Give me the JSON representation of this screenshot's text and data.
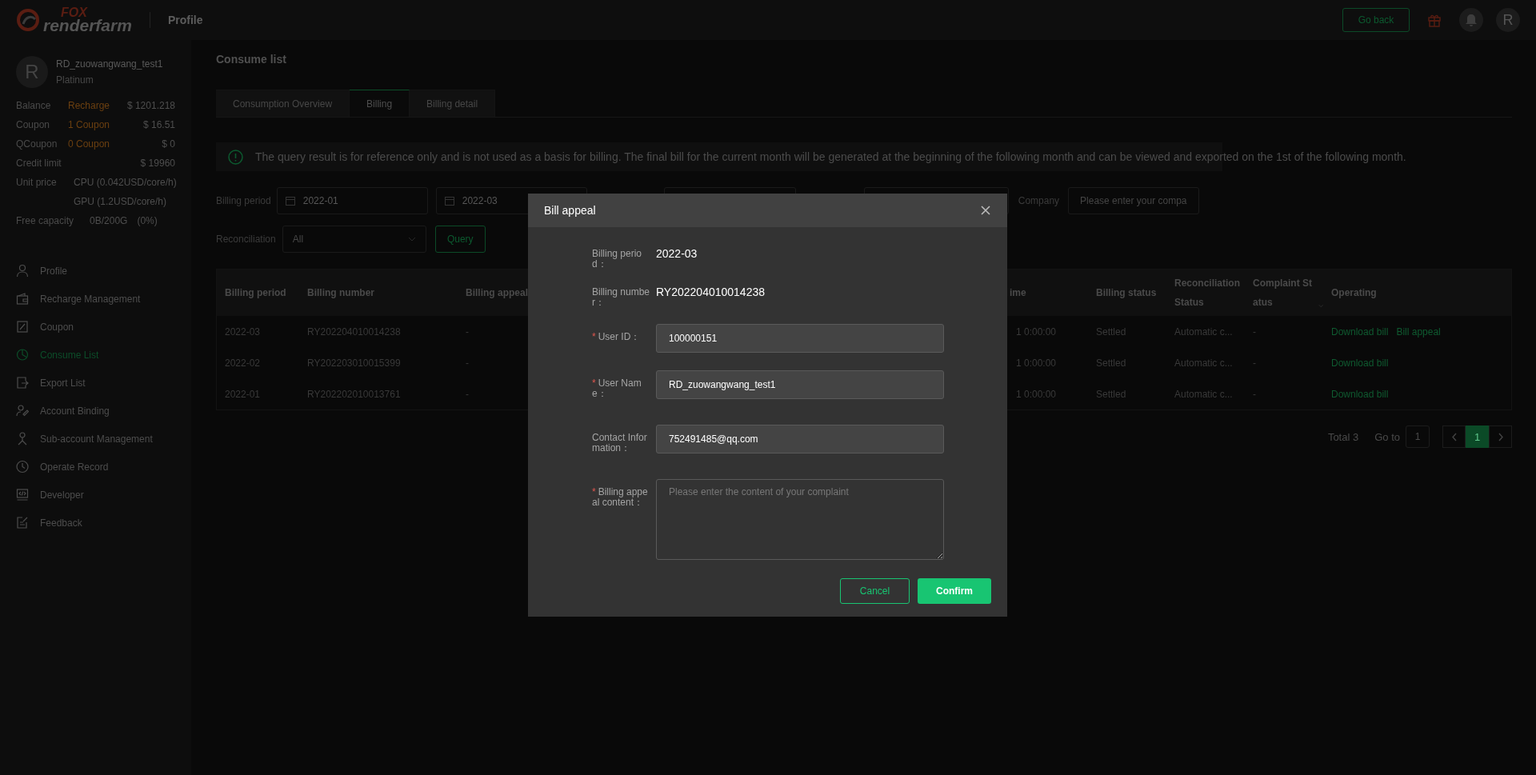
{
  "header": {
    "logo_top": "FOX",
    "logo_bottom": "renderfarm",
    "title": "Profile",
    "go_back": "Go back",
    "avatar": "R"
  },
  "user": {
    "avatar": "R",
    "name": "RD_zuowangwang_test1",
    "level": "Platinum"
  },
  "account": [
    {
      "label": "Balance",
      "link": "Recharge",
      "value": "$ 1201.218"
    },
    {
      "label": "Coupon",
      "link": "1 Coupon",
      "value": "$ 16.51"
    },
    {
      "label": "QCoupon",
      "link": "0 Coupon",
      "value": "$ 0"
    },
    {
      "label": "Credit limit",
      "value": "$ 19960"
    }
  ],
  "unit_price": {
    "label": "Unit price",
    "lines": [
      "CPU (0.042USD/core/h)",
      "GPU (1.2USD/core/h)"
    ]
  },
  "free_capacity": {
    "label": "Free capacity",
    "value": "0B/200G",
    "percent": "(0%)"
  },
  "nav": [
    {
      "label": "Profile",
      "selected": false
    },
    {
      "label": "Recharge Management",
      "selected": false
    },
    {
      "label": "Coupon",
      "selected": false
    },
    {
      "label": "Consume List",
      "selected": true
    },
    {
      "label": "Export List",
      "selected": false
    },
    {
      "label": "Account Binding",
      "selected": false
    },
    {
      "label": "Sub-account Management",
      "selected": false
    },
    {
      "label": "Operate Record",
      "selected": false
    },
    {
      "label": "Developer",
      "selected": false
    },
    {
      "label": "Feedback",
      "selected": false
    }
  ],
  "page_title": "Consume list",
  "tabs": [
    {
      "label": "Consumption Overview",
      "selected": false
    },
    {
      "label": "Billing",
      "selected": true
    },
    {
      "label": "Billing detail",
      "selected": false
    }
  ],
  "notice": "The query result is for reference only and is not used as a basis for billing. The final bill for the current month will be generated at the beginning of the following month and can be viewed and exported on the 1st of the following month.",
  "filters": {
    "period_label": "Billing period",
    "from": "2022-01",
    "to": "2022-03",
    "company_label": "Company",
    "company_placeholder": "Please enter your compa",
    "reconciliation_label": "Reconciliation",
    "reconciliation_value": "All",
    "query": "Query"
  },
  "table": {
    "columns": [
      "Billing period",
      "Billing number",
      "Billing appeal",
      "ime",
      "Billing status",
      "Reconciliation Status",
      "Complaint Status",
      "Operating"
    ],
    "rows": [
      {
        "cells": [
          "2022-03",
          "RY202204010014238",
          "-",
          "1 0:00:00",
          "Settled",
          "Automatic c...",
          "-"
        ],
        "actions": [
          "Download bill",
          "Bill appeal"
        ]
      },
      {
        "cells": [
          "2022-02",
          "RY202203010015399",
          "-",
          "1 0:00:00",
          "Settled",
          "Automatic c...",
          "-"
        ],
        "actions": [
          "Download bill"
        ]
      },
      {
        "cells": [
          "2022-01",
          "RY202202010013761",
          "-",
          "1 0:00:00",
          "Settled",
          "Automatic c...",
          "-"
        ],
        "actions": [
          "Download bill"
        ]
      }
    ]
  },
  "pagination": {
    "total": "Total 3",
    "goto_label": "Go to",
    "goto_value": "1",
    "pages": [
      {
        "label": "1",
        "selected": true
      }
    ]
  },
  "modal": {
    "title": "Bill appeal",
    "fields": [
      {
        "kind": "static",
        "label": "Billing period：",
        "value": "2022-03"
      },
      {
        "kind": "static",
        "label": "Billing number：",
        "value": "RY202204010014238"
      },
      {
        "kind": "input",
        "required_mark": "*",
        "label": "User ID：",
        "value": "100000151"
      },
      {
        "kind": "input",
        "required_mark": "*",
        "label": "User Name：",
        "value": "RD_zuowangwang_test1"
      },
      {
        "kind": "input",
        "label": "Contact Information：",
        "value": "752491485@qq.com"
      },
      {
        "kind": "textarea",
        "required_mark": "*",
        "label": "Billing appeal content：",
        "placeholder": "Please enter the content of your complaint"
      }
    ],
    "cancel": "Cancel",
    "confirm": "Confirm"
  }
}
